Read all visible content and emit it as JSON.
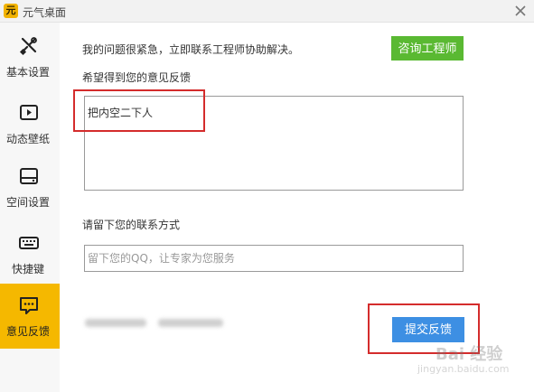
{
  "window": {
    "title": "元气桌面",
    "logo_text": "元",
    "close_icon": "close-icon"
  },
  "sidebar": {
    "items": [
      {
        "label": "基本设置",
        "icon": "tools-icon",
        "active": false
      },
      {
        "label": "动态壁纸",
        "icon": "play-screen-icon",
        "active": false
      },
      {
        "label": "空间设置",
        "icon": "disk-icon",
        "active": false
      },
      {
        "label": "快捷键",
        "icon": "keyboard-icon",
        "active": false
      },
      {
        "label": "意见反馈",
        "icon": "feedback-bubble-icon",
        "active": true
      }
    ]
  },
  "main": {
    "urgent_text": "我的问题很紧急，立即联系工程师协助解决。",
    "consult_button": "咨询工程师",
    "feedback_label": "希望得到您的意见反馈",
    "feedback_value": "把内空二下人",
    "contact_label": "请留下您的联系方式",
    "contact_placeholder": "留下您的QQ，让专家为您服务",
    "contact_value": "",
    "submit_button": "提交反馈"
  },
  "watermark": {
    "main": "Bai 经验",
    "sub": "jingyan.baidu.com"
  },
  "colors": {
    "sidebar_active": "#f5b800",
    "consult_button": "#5ab932",
    "submit_button": "#3d8fe3",
    "annotation": "#d42c2c"
  }
}
